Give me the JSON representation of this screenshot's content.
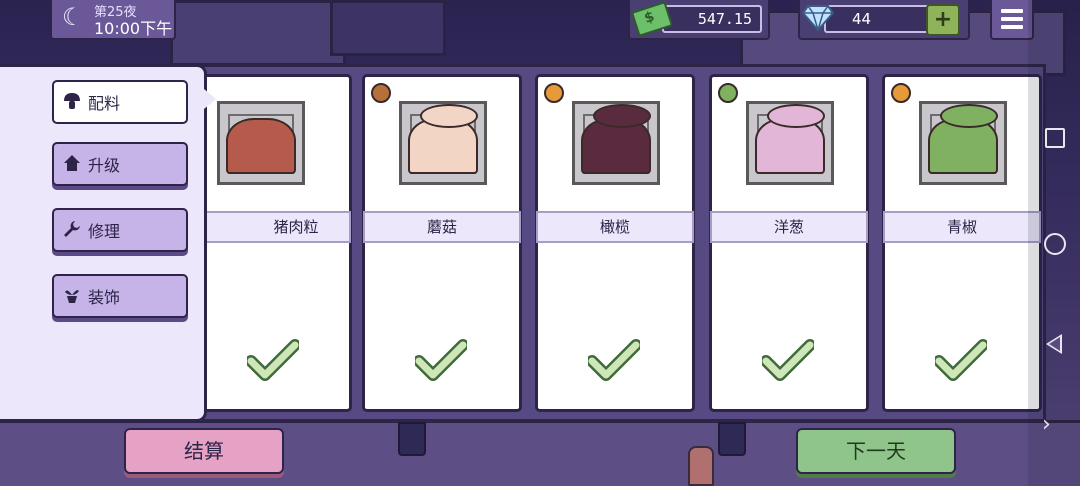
{
  "hud": {
    "day": "第25夜",
    "time": "10:00下午",
    "money": "547.15",
    "gems": "44",
    "plus_label": "+"
  },
  "side_menu": {
    "items": [
      {
        "label": "配料",
        "icon": "mushroom-icon",
        "active": true
      },
      {
        "label": "升级",
        "icon": "house-icon",
        "active": false
      },
      {
        "label": "修理",
        "icon": "wrench-icon",
        "active": false
      },
      {
        "label": "装饰",
        "icon": "plant-pot-icon",
        "active": false
      }
    ]
  },
  "ingredients": [
    {
      "name": "猪肉粒",
      "badge": "none",
      "color": "#b65b4c",
      "status": "checked"
    },
    {
      "name": "蘑菇",
      "badge": "mushroom-icon",
      "color": "#f2d5c4",
      "status": "checked"
    },
    {
      "name": "橄榄",
      "badge": "orange-icon",
      "color": "#5a2a3e",
      "status": "checked"
    },
    {
      "name": "洋葱",
      "badge": "pepper-icon",
      "color": "#e2b6d6",
      "status": "checked"
    },
    {
      "name": "青椒",
      "badge": "orange-icon",
      "color": "#7fb160",
      "status": "checked"
    }
  ],
  "buttons": {
    "settle": "结算",
    "next_day": "下一天"
  },
  "nav": {
    "chevron": "›"
  },
  "colors": {
    "panel": "#ece7fa",
    "button_purple": "#c6b4e8",
    "settle_pink": "#e6a2c4",
    "next_green": "#8fc58a",
    "check_green": "#cfe6b8"
  }
}
